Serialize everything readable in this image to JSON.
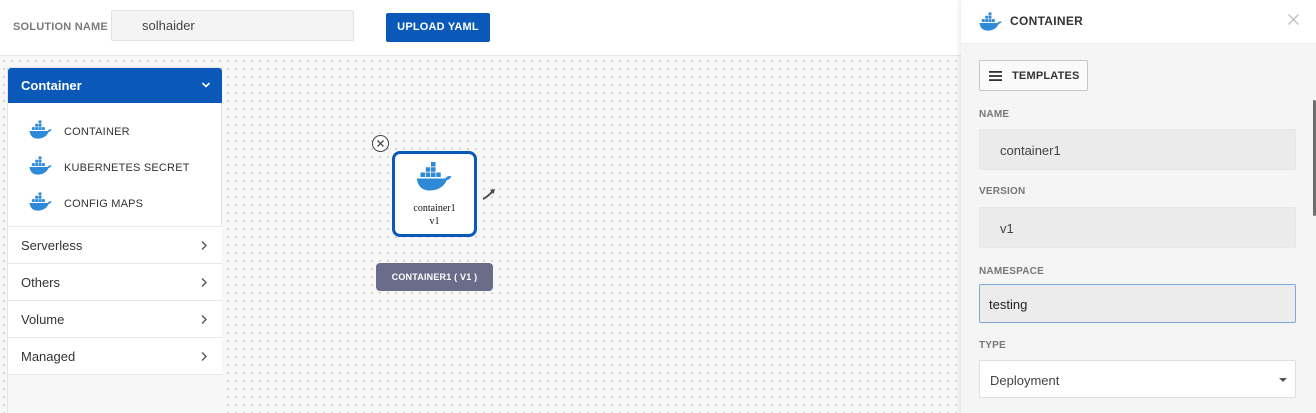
{
  "topbar": {
    "solution_label": "SOLUTION NAME",
    "solution_value": "solhaider",
    "upload_label": "UPLOAD YAML"
  },
  "palette": {
    "header": "Container",
    "items": [
      {
        "label": "CONTAINER",
        "icon": "docker-icon"
      },
      {
        "label": "KUBERNETES SECRET",
        "icon": "docker-icon"
      },
      {
        "label": "CONFIG MAPS",
        "icon": "docker-icon"
      }
    ],
    "groups": [
      {
        "label": "Serverless"
      },
      {
        "label": "Others"
      },
      {
        "label": "Volume"
      },
      {
        "label": "Managed"
      }
    ]
  },
  "node": {
    "name": "container1",
    "version": "v1",
    "tag": "CONTAINER1 ( V1 )"
  },
  "panel": {
    "title": "CONTAINER",
    "templates_label": "TEMPLATES",
    "fields": {
      "name_label": "NAME",
      "name_value": "container1",
      "version_label": "VERSION",
      "version_value": "v1",
      "namespace_label": "NAMESPACE",
      "namespace_value": "testing",
      "type_label": "TYPE",
      "type_value": "Deployment"
    }
  },
  "colors": {
    "primary": "#0a59b9",
    "docker": "#2e8ad6",
    "tag": "#6b6b8a"
  }
}
